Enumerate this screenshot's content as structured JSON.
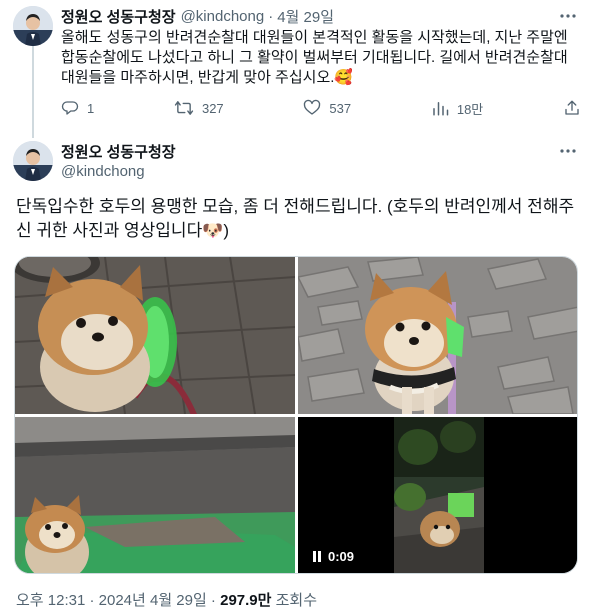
{
  "tweet1": {
    "display_name": "정원오 성동구청장",
    "handle": "@kindchong",
    "separator": "·",
    "date": "4월 29일",
    "text": "올해도 성동구의 반려견순찰대 대원들이 본격적인 활동을 시작했는데, 지난 주말엔 합동순찰에도 나섰다고 하니 그 활약이 벌써부터 기대됩니다. 길에서 반려견순찰대 대원들을 마주하시면, 반갑게 맞아 주십시오.",
    "emoji": "🥰",
    "actions": {
      "reply_count": "1",
      "retweet_count": "327",
      "like_count": "537",
      "view_count": "18만"
    }
  },
  "tweet2": {
    "display_name": "정원오 성동구청장",
    "handle": "@kindchong",
    "text": "단독입수한 호두의 용맹한 모습, 좀 더 전해드립니다. (호두의 반려인께서 전해주신 귀한 사진과 영상입니다",
    "text_end": ")",
    "emoji": "🐶",
    "video_duration": "0:09",
    "timestamp": "오후 12:31 · 2024년 4월 29일 · ",
    "views_value": "297.9만",
    "views_label": " 조회수"
  },
  "colors": {
    "text_primary": "#0f1419",
    "text_secondary": "#536471",
    "border": "#cfd9de"
  },
  "icons": [
    "more-icon",
    "reply-icon",
    "retweet-icon",
    "like-icon",
    "views-icon",
    "share-icon",
    "pause-icon"
  ]
}
